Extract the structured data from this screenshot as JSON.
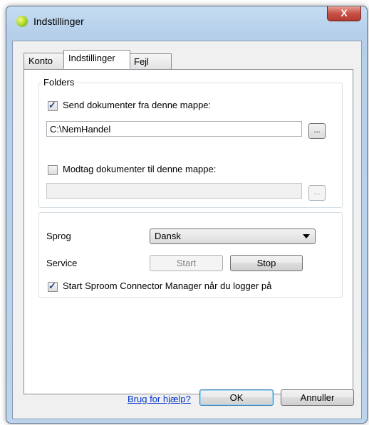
{
  "window": {
    "title": "Indstillinger",
    "close_glyph": "X"
  },
  "tabs": [
    {
      "label": "Konto"
    },
    {
      "label": "Indstillinger"
    },
    {
      "label": "Fejl"
    }
  ],
  "folders": {
    "legend": "Folders",
    "send": {
      "checked": true,
      "label": "Send dokumenter fra denne mappe:",
      "path": "C:\\NemHandel",
      "browse_label": "..."
    },
    "receive": {
      "checked": false,
      "label": "Modtag dokumenter til denne mappe:",
      "path": "",
      "browse_label": "..."
    }
  },
  "settings": {
    "language_label": "Sprog",
    "language_value": "Dansk",
    "service_label": "Service",
    "start_label": "Start",
    "stop_label": "Stop",
    "autostart_checked": true,
    "autostart_label": "Start Sproom Connector Manager når du logger på"
  },
  "footer": {
    "help_link": "Brug for hjælp?",
    "ok_label": "OK",
    "cancel_label": "Annuller"
  }
}
